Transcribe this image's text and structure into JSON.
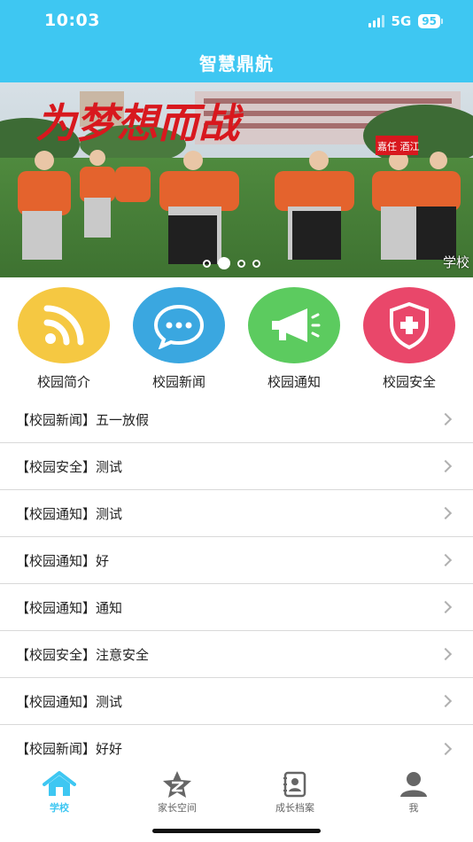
{
  "status_bar": {
    "time": "10:03",
    "network": "5G",
    "battery": "95"
  },
  "app_title": "智慧鼎航",
  "banner": {
    "headline": "为梦想而战",
    "badge": "嘉任 酒江",
    "caption": "学校",
    "dots": 4,
    "active_dot": 2
  },
  "quick_links": [
    {
      "label": "校园简介",
      "icon": "rss-icon",
      "color": "#f5c842"
    },
    {
      "label": "校园新闻",
      "icon": "chat-bubble-icon",
      "color": "#3aa7e0"
    },
    {
      "label": "校园通知",
      "icon": "megaphone-icon",
      "color": "#5ccb5f"
    },
    {
      "label": "校园安全",
      "icon": "shield-plus-icon",
      "color": "#e9476a"
    }
  ],
  "news": [
    "【校园新闻】五一放假",
    "【校园安全】测试",
    "【校园通知】测试",
    "【校园通知】好",
    "【校园通知】通知",
    "【校园安全】注意安全",
    "【校园通知】测试",
    "【校园新闻】好好"
  ],
  "tabs": [
    {
      "label": "学校",
      "icon": "home-icon",
      "active": true
    },
    {
      "label": "家长空间",
      "icon": "star-icon",
      "active": false
    },
    {
      "label": "成长档案",
      "icon": "profile-book-icon",
      "active": false
    },
    {
      "label": "我",
      "icon": "user-icon",
      "active": false
    }
  ],
  "colors": {
    "primary": "#3ec7f2",
    "tab_inactive": "#666666"
  }
}
